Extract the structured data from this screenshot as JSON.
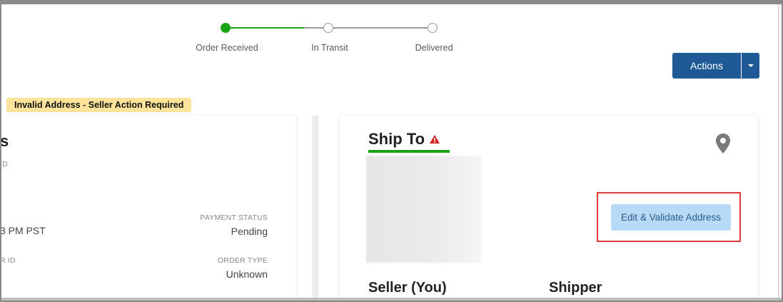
{
  "tracker": {
    "steps": [
      {
        "label": "Order Received",
        "done": true
      },
      {
        "label": "In Transit",
        "done": false
      },
      {
        "label": "Delivered",
        "done": false
      }
    ],
    "progress_color": "#1aa312"
  },
  "actions": {
    "label": "Actions",
    "color": "#1f5a96"
  },
  "warning_badge": {
    "text": "Invalid Address - Seller Action Required",
    "color": "#fde49a"
  },
  "order_card": {
    "title_fragment": "s",
    "id_label_fragment": "ID",
    "time_fragment": "3 PM PST",
    "payment_status_label": "PAYMENT STATUS",
    "payment_status_value": "Pending",
    "id2_label_fragment": "R ID",
    "order_type_label": "ORDER TYPE",
    "order_type_value": "Unknown"
  },
  "ship_card": {
    "title": "Ship To",
    "warning_icon": "warning-triangle-icon",
    "location_icon": "map-pin-icon",
    "edit_button": "Edit & Validate Address",
    "highlight_color": "#e03a3a",
    "seller_heading": "Seller (You)",
    "shipper_heading": "Shipper"
  }
}
